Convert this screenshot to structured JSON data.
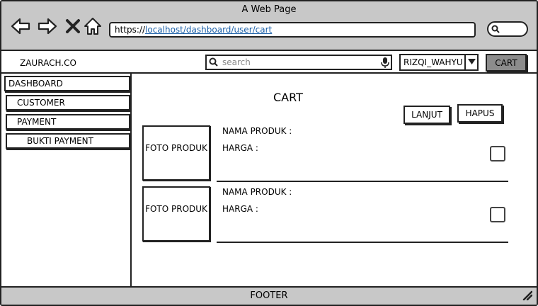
{
  "window": {
    "title": "A Web Page"
  },
  "browser": {
    "url_prefix": "https://",
    "url_link": "localhost/dashboard/user/cart",
    "nav_icons": [
      "back-arrow-icon",
      "forward-arrow-icon",
      "close-x-icon",
      "home-icon"
    ]
  },
  "topbar": {
    "brand": "ZAURACH.CO",
    "search_placeholder": "search",
    "user": "RIZQI_WAHYU",
    "cart_label": "CART"
  },
  "sidebar": {
    "items": [
      {
        "label": "DASHBOARD"
      },
      {
        "label": "CUSTOMER"
      },
      {
        "label": "PAYMENT"
      },
      {
        "label": "BUKTI PAYMENT"
      }
    ]
  },
  "main": {
    "title": "CART",
    "lanjut_label": "LANJUT",
    "hapus_label": "HAPUS",
    "products": [
      {
        "photo_label": "FOTO PRODUK",
        "name_label": "NAMA PRODUK :",
        "price_label": "HARGA :"
      },
      {
        "photo_label": "FOTO PRODUK",
        "name_label": "NAMA PRODUK :",
        "price_label": "HARGA :"
      }
    ]
  },
  "footer": {
    "label": "FOOTER"
  }
}
